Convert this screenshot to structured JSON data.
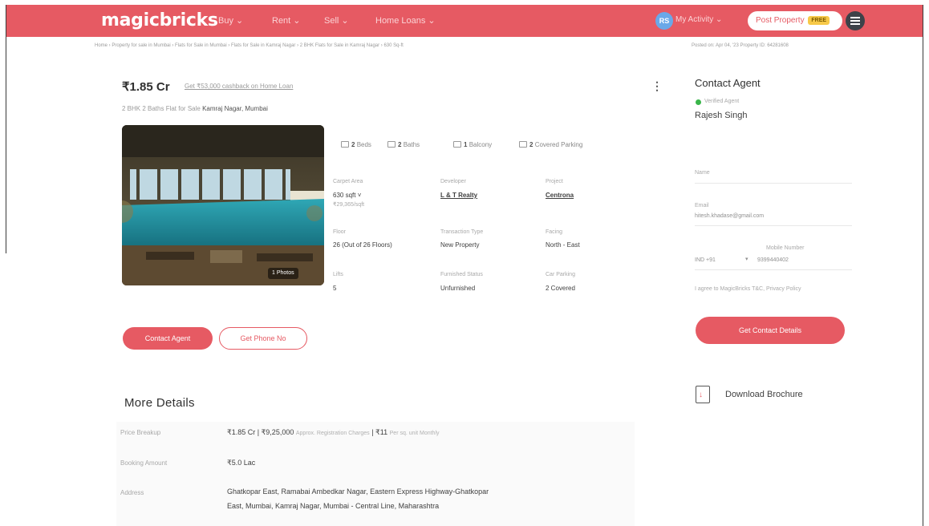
{
  "header": {
    "logo": "magicbricks",
    "nav": [
      {
        "label": "Buy ⌄"
      },
      {
        "label": "Rent ⌄"
      },
      {
        "label": "Sell ⌄"
      },
      {
        "label": "Home Loans ⌄"
      }
    ],
    "user_initials": "RS",
    "user_label": "My Activity ⌄",
    "post_property_label": "Post Property",
    "post_property_badge": "FREE",
    "brand_color": "#e65a63"
  },
  "breadcrumb": "Home › Property for sale in Mumbai › Flats for Sale in Mumbai › Flats for Sale in Kamraj Nagar › 2 BHK Flats for Sale in Kamraj Nagar › 630 Sq-ft",
  "posted": "Posted on: Apr 04, '23     Property ID: 64281608",
  "listing": {
    "price": "₹1.85 Cr",
    "loan_text": "Get ₹53,000 cashback on Home Loan",
    "subtitle_prefix": "2 BHK 2 Baths Flat for Sale",
    "subtitle_locality": "Kamraj Nagar, Mumbai",
    "photos_label": "1 Photos",
    "amenities": [
      {
        "icon": "bed-icon",
        "value": "2",
        "label": "Beds"
      },
      {
        "icon": "bath-icon",
        "value": "2",
        "label": "Baths"
      },
      {
        "icon": "balcony-icon",
        "value": "1",
        "label": "Balcony"
      },
      {
        "icon": "parking-icon",
        "value": "2",
        "label": "Covered Parking"
      }
    ],
    "summary": [
      {
        "label": "Carpet Area",
        "value": "630 sqft ˅",
        "sub": "₹29,365/sqft"
      },
      {
        "label": "Developer",
        "value": "L & T Realty"
      },
      {
        "label": "Project",
        "value": "Centrona"
      },
      {
        "label": "Floor",
        "value": "26 (Out of 26 Floors)"
      },
      {
        "label": "Transaction Type",
        "value": "New Property"
      },
      {
        "label": "Facing",
        "value": "North - East"
      },
      {
        "label": "Lifts",
        "value": "5"
      },
      {
        "label": "Furnished Status",
        "value": "Unfurnished"
      },
      {
        "label": "Car Parking",
        "value": "2 Covered"
      }
    ],
    "contact_button": "Contact Agent",
    "phone_button": "Get Phone No"
  },
  "more_details": {
    "title": "More Details",
    "rows": [
      {
        "label": "Price Breakup",
        "value": "₹1.85 Cr | ₹9,25,000",
        "note": "Approx. Registration Charges",
        "value2": "| ₹11",
        "note2": "Per sq. unit Monthly"
      },
      {
        "label": "Booking Amount",
        "value": "₹5.0 Lac"
      },
      {
        "label": "Address",
        "value": "Ghatkopar East, Ramabai Ambedkar Nagar, Eastern Express Highway-Ghatkopar",
        "value_line2": "East, Mumbai, Kamraj Nagar, Mumbai - Central Line, Maharashtra"
      }
    ]
  },
  "agent_panel": {
    "title": "Contact Agent",
    "verified_label": "Verified Agent",
    "agent_name": "Rajesh Singh",
    "name_label": "Name",
    "email_label": "Email",
    "email_value": "hitesh.khadase@gmail.com",
    "phone_label": "Mobile Number",
    "country_code": "IND +91",
    "phone_value": "9399440402",
    "interest_text": "I agree to MagicBricks T&C, Privacy Policy",
    "details_button": "Get Contact Details",
    "brochure_label": "Download Brochure"
  }
}
